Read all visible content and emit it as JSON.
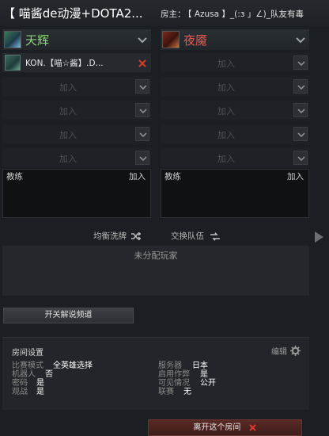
{
  "lobby": {
    "title": "【 喵酱de动漫+DOTA2...",
    "host_label": "房主：",
    "host_name": "【 Azusa 】_(:з 」∠)_队友有毒"
  },
  "teams": {
    "radiant": {
      "name": "天辉",
      "color": "#8fd37a",
      "player": {
        "name": "KON.【喵☆酱】.D..."
      },
      "join_label": "加入",
      "coach_label": "教练",
      "coach_join": "加入"
    },
    "dire": {
      "name": "夜魇",
      "color": "#e65a4e",
      "join_label": "加入",
      "coach_label": "教练",
      "coach_join": "加入"
    }
  },
  "actions": {
    "shuffle_label": "均衡洗牌",
    "swap_label": "交换队伍"
  },
  "unassigned": {
    "title": "未分配玩家"
  },
  "broadcast_button": "开关解说频道",
  "settings": {
    "title": "房间设置",
    "edit_label": "编辑",
    "rows": [
      {
        "label": "比赛模式",
        "value": "全英雄选择"
      },
      {
        "label": "机器人",
        "value": "否"
      },
      {
        "label": "密码",
        "value": "是"
      },
      {
        "label": "观战",
        "value": "是"
      },
      {
        "label": "服务器",
        "value": "日本"
      },
      {
        "label": "启用作弊",
        "value": "是"
      },
      {
        "label": "可见情况",
        "value": "公开"
      },
      {
        "label": "联赛",
        "value": "无"
      }
    ]
  },
  "leave_button": "离开这个房间",
  "colors": {
    "radiant": "#8fd37a",
    "dire": "#e65a4e",
    "kick": "#d83a2e"
  }
}
